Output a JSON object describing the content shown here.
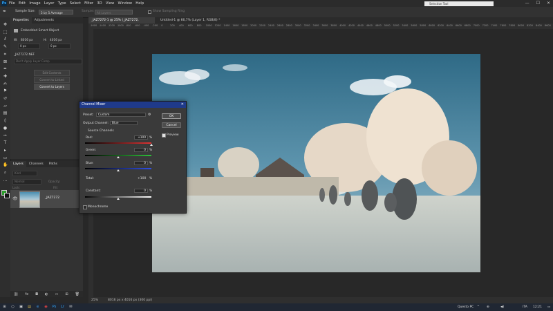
{
  "app": {
    "logo": "Ps"
  },
  "menu": [
    "File",
    "Edit",
    "Image",
    "Layer",
    "Type",
    "Select",
    "Filter",
    "3D",
    "View",
    "Window",
    "Help"
  ],
  "search": {
    "placeholder": "Selection Tool"
  },
  "window_controls": [
    "—",
    "☐",
    "✕"
  ],
  "options_bar": {
    "sample_size_label": "Sample Size:",
    "sample_size_value": "5 by 5 Average",
    "sample_label": "Sample:",
    "sample_value": "All Layers",
    "show_ring_label": "Show Sampling Ring"
  },
  "properties": {
    "tabs": [
      "Properties",
      "Adjustments"
    ],
    "object_type": "Embedded Smart Object",
    "w_label": "W:",
    "w_value": "8016 px",
    "h_label": "H:",
    "h_value": "4016 px",
    "x_value": "0 px",
    "y_value": "0 px",
    "filename": "_JAZ7272.NEF",
    "layer_comp": "Don't Apply Layer Comp",
    "buttons": [
      "Edit Contents",
      "Convert to Linked",
      "Convert to Layers"
    ]
  },
  "layers": {
    "tabs": [
      "Layers",
      "Channels",
      "Paths"
    ],
    "kind": "Kind",
    "blend": "Normal",
    "opacity_label": "Opacity:",
    "lock_label": "Lock:",
    "fill_label": "Fill:",
    "layer_name": "_JAZ7272"
  },
  "documents": {
    "tab1": "_JAZ7272-1 @ 25% (_JAZ7272, RGB/16) *",
    "tab2": "Untitled-1 @ 66,7% (Layer 1, RGB/8) *"
  },
  "ruler_ticks": [
    "-1600",
    "-1400",
    "-1200",
    "-1000",
    "-800",
    "-600",
    "-400",
    "-200",
    "0",
    "200",
    "400",
    "600",
    "800",
    "1000",
    "1200",
    "1400",
    "1600",
    "1800",
    "2000",
    "2200",
    "2400",
    "2600",
    "2800",
    "3000",
    "3200",
    "3400",
    "3600",
    "3800",
    "4000",
    "4200",
    "4400",
    "4600",
    "4800",
    "5000",
    "5200",
    "5400",
    "5600",
    "5800",
    "6000",
    "6200",
    "6400",
    "6600",
    "6800",
    "7000",
    "7200",
    "7400",
    "7600",
    "7800",
    "8000",
    "8200",
    "8400",
    "8600"
  ],
  "status": {
    "zoom": "25%",
    "size": "8016 px x 4016 px (300 ppi)"
  },
  "channel_mixer": {
    "title": "Channel Mixer",
    "preset_label": "Preset:",
    "preset_value": "Custom",
    "output_label": "Output Channel:",
    "output_value": "Blue",
    "source_label": "Source Channels",
    "red_label": "Red:",
    "red_value": "+100",
    "green_label": "Green:",
    "green_value": "0",
    "blue_label": "Blue:",
    "blue_value": "0",
    "pct": "%",
    "total_label": "Total:",
    "total_value": "+100",
    "constant_label": "Constant:",
    "constant_value": "0",
    "monochrome_label": "Monochrome",
    "ok_label": "OK",
    "cancel_label": "Cancel",
    "preview_label": "Preview",
    "red_level": 1.0,
    "green_level": 0.5,
    "blue_level": 0.5,
    "constant_level": 0.5
  },
  "taskbar": {
    "pc_label": "Questo PC",
    "lang": "ITA",
    "time": "12:21"
  }
}
